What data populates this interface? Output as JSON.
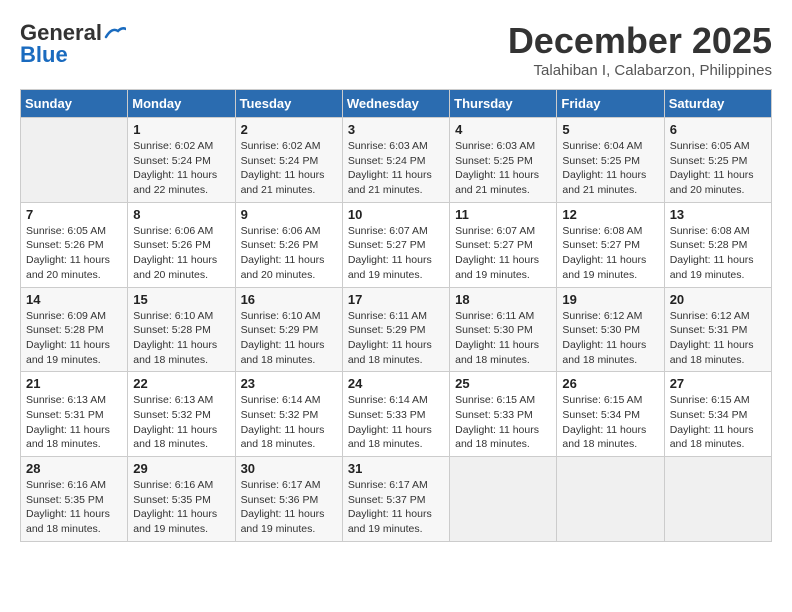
{
  "header": {
    "logo_general": "General",
    "logo_blue": "Blue",
    "month_year": "December 2025",
    "location": "Talahiban I, Calabarzon, Philippines"
  },
  "weekdays": [
    "Sunday",
    "Monday",
    "Tuesday",
    "Wednesday",
    "Thursday",
    "Friday",
    "Saturday"
  ],
  "weeks": [
    [
      {
        "day": null,
        "sunrise": null,
        "sunset": null,
        "daylight": null
      },
      {
        "day": "1",
        "sunrise": "Sunrise: 6:02 AM",
        "sunset": "Sunset: 5:24 PM",
        "daylight": "Daylight: 11 hours and 22 minutes."
      },
      {
        "day": "2",
        "sunrise": "Sunrise: 6:02 AM",
        "sunset": "Sunset: 5:24 PM",
        "daylight": "Daylight: 11 hours and 21 minutes."
      },
      {
        "day": "3",
        "sunrise": "Sunrise: 6:03 AM",
        "sunset": "Sunset: 5:24 PM",
        "daylight": "Daylight: 11 hours and 21 minutes."
      },
      {
        "day": "4",
        "sunrise": "Sunrise: 6:03 AM",
        "sunset": "Sunset: 5:25 PM",
        "daylight": "Daylight: 11 hours and 21 minutes."
      },
      {
        "day": "5",
        "sunrise": "Sunrise: 6:04 AM",
        "sunset": "Sunset: 5:25 PM",
        "daylight": "Daylight: 11 hours and 21 minutes."
      },
      {
        "day": "6",
        "sunrise": "Sunrise: 6:05 AM",
        "sunset": "Sunset: 5:25 PM",
        "daylight": "Daylight: 11 hours and 20 minutes."
      }
    ],
    [
      {
        "day": "7",
        "sunrise": "Sunrise: 6:05 AM",
        "sunset": "Sunset: 5:26 PM",
        "daylight": "Daylight: 11 hours and 20 minutes."
      },
      {
        "day": "8",
        "sunrise": "Sunrise: 6:06 AM",
        "sunset": "Sunset: 5:26 PM",
        "daylight": "Daylight: 11 hours and 20 minutes."
      },
      {
        "day": "9",
        "sunrise": "Sunrise: 6:06 AM",
        "sunset": "Sunset: 5:26 PM",
        "daylight": "Daylight: 11 hours and 20 minutes."
      },
      {
        "day": "10",
        "sunrise": "Sunrise: 6:07 AM",
        "sunset": "Sunset: 5:27 PM",
        "daylight": "Daylight: 11 hours and 19 minutes."
      },
      {
        "day": "11",
        "sunrise": "Sunrise: 6:07 AM",
        "sunset": "Sunset: 5:27 PM",
        "daylight": "Daylight: 11 hours and 19 minutes."
      },
      {
        "day": "12",
        "sunrise": "Sunrise: 6:08 AM",
        "sunset": "Sunset: 5:27 PM",
        "daylight": "Daylight: 11 hours and 19 minutes."
      },
      {
        "day": "13",
        "sunrise": "Sunrise: 6:08 AM",
        "sunset": "Sunset: 5:28 PM",
        "daylight": "Daylight: 11 hours and 19 minutes."
      }
    ],
    [
      {
        "day": "14",
        "sunrise": "Sunrise: 6:09 AM",
        "sunset": "Sunset: 5:28 PM",
        "daylight": "Daylight: 11 hours and 19 minutes."
      },
      {
        "day": "15",
        "sunrise": "Sunrise: 6:10 AM",
        "sunset": "Sunset: 5:28 PM",
        "daylight": "Daylight: 11 hours and 18 minutes."
      },
      {
        "day": "16",
        "sunrise": "Sunrise: 6:10 AM",
        "sunset": "Sunset: 5:29 PM",
        "daylight": "Daylight: 11 hours and 18 minutes."
      },
      {
        "day": "17",
        "sunrise": "Sunrise: 6:11 AM",
        "sunset": "Sunset: 5:29 PM",
        "daylight": "Daylight: 11 hours and 18 minutes."
      },
      {
        "day": "18",
        "sunrise": "Sunrise: 6:11 AM",
        "sunset": "Sunset: 5:30 PM",
        "daylight": "Daylight: 11 hours and 18 minutes."
      },
      {
        "day": "19",
        "sunrise": "Sunrise: 6:12 AM",
        "sunset": "Sunset: 5:30 PM",
        "daylight": "Daylight: 11 hours and 18 minutes."
      },
      {
        "day": "20",
        "sunrise": "Sunrise: 6:12 AM",
        "sunset": "Sunset: 5:31 PM",
        "daylight": "Daylight: 11 hours and 18 minutes."
      }
    ],
    [
      {
        "day": "21",
        "sunrise": "Sunrise: 6:13 AM",
        "sunset": "Sunset: 5:31 PM",
        "daylight": "Daylight: 11 hours and 18 minutes."
      },
      {
        "day": "22",
        "sunrise": "Sunrise: 6:13 AM",
        "sunset": "Sunset: 5:32 PM",
        "daylight": "Daylight: 11 hours and 18 minutes."
      },
      {
        "day": "23",
        "sunrise": "Sunrise: 6:14 AM",
        "sunset": "Sunset: 5:32 PM",
        "daylight": "Daylight: 11 hours and 18 minutes."
      },
      {
        "day": "24",
        "sunrise": "Sunrise: 6:14 AM",
        "sunset": "Sunset: 5:33 PM",
        "daylight": "Daylight: 11 hours and 18 minutes."
      },
      {
        "day": "25",
        "sunrise": "Sunrise: 6:15 AM",
        "sunset": "Sunset: 5:33 PM",
        "daylight": "Daylight: 11 hours and 18 minutes."
      },
      {
        "day": "26",
        "sunrise": "Sunrise: 6:15 AM",
        "sunset": "Sunset: 5:34 PM",
        "daylight": "Daylight: 11 hours and 18 minutes."
      },
      {
        "day": "27",
        "sunrise": "Sunrise: 6:15 AM",
        "sunset": "Sunset: 5:34 PM",
        "daylight": "Daylight: 11 hours and 18 minutes."
      }
    ],
    [
      {
        "day": "28",
        "sunrise": "Sunrise: 6:16 AM",
        "sunset": "Sunset: 5:35 PM",
        "daylight": "Daylight: 11 hours and 18 minutes."
      },
      {
        "day": "29",
        "sunrise": "Sunrise: 6:16 AM",
        "sunset": "Sunset: 5:35 PM",
        "daylight": "Daylight: 11 hours and 19 minutes."
      },
      {
        "day": "30",
        "sunrise": "Sunrise: 6:17 AM",
        "sunset": "Sunset: 5:36 PM",
        "daylight": "Daylight: 11 hours and 19 minutes."
      },
      {
        "day": "31",
        "sunrise": "Sunrise: 6:17 AM",
        "sunset": "Sunset: 5:37 PM",
        "daylight": "Daylight: 11 hours and 19 minutes."
      },
      {
        "day": null,
        "sunrise": null,
        "sunset": null,
        "daylight": null
      },
      {
        "day": null,
        "sunrise": null,
        "sunset": null,
        "daylight": null
      },
      {
        "day": null,
        "sunrise": null,
        "sunset": null,
        "daylight": null
      }
    ]
  ]
}
